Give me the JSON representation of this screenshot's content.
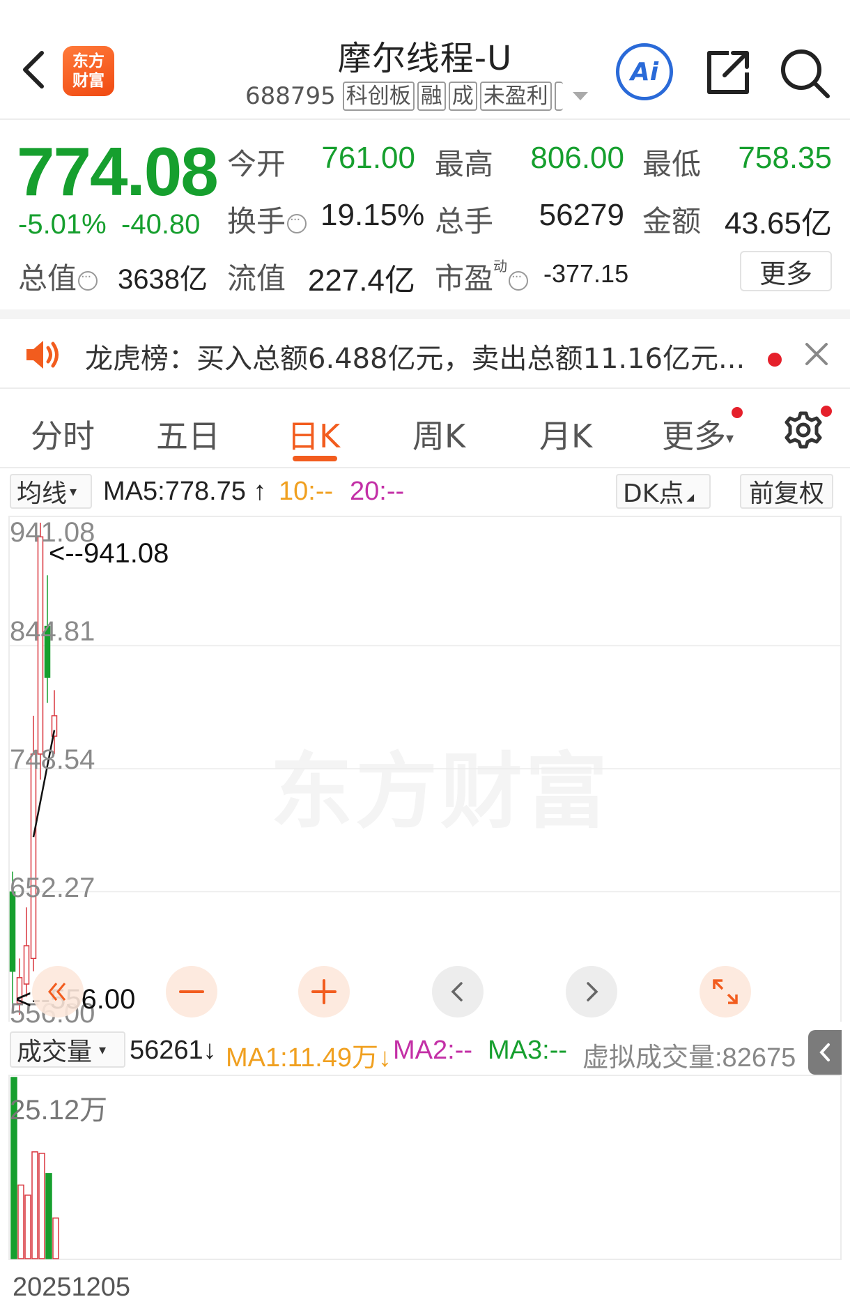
{
  "header": {
    "logo_line1": "东方",
    "logo_line2": "财富",
    "stock_name": "摩尔线程-U",
    "stock_code": "688795",
    "tags": [
      "科创板",
      "融",
      "成",
      "未盈利"
    ],
    "ai_label": "Ai"
  },
  "quote": {
    "price": "774.08",
    "change_pct": "-5.01%",
    "change_amt": "-40.80",
    "open_label": "今开",
    "open": "761.00",
    "high_label": "最高",
    "high": "806.00",
    "low_label": "最低",
    "low": "758.35",
    "turnover_label": "换手",
    "turnover": "19.15%",
    "volume_label": "总手",
    "volume": "56279",
    "amount_label": "金额",
    "amount": "43.65亿",
    "mktcap_label": "总值",
    "mktcap": "3638亿",
    "float_label": "流值",
    "float_cap": "227.4亿",
    "pe_label": "市盈",
    "pe_sup": "动",
    "pe": "-377.15",
    "more_label": "更多"
  },
  "notice": {
    "text": "龙虎榜：买入总额6.488亿元，卖出总额11.16亿元..."
  },
  "tabs": {
    "items": [
      "分时",
      "五日",
      "日K",
      "周K",
      "月K",
      "更多"
    ],
    "active": "日K"
  },
  "indicator_bar": {
    "ma_select": "均线",
    "ma5": "MA5:778.75",
    "ma10": "10:--",
    "ma20": "20:--",
    "dk_label": "DK点",
    "adjust_label": "前复权"
  },
  "chart_data": {
    "type": "candlestick",
    "y_ticks": [
      "941.08",
      "844.81",
      "748.54",
      "652.27",
      "556.00"
    ],
    "ylim": [
      556.0,
      941.08
    ],
    "max_marker": "<--941.08",
    "min_marker": "<--556.00",
    "candles": [
      {
        "open": 652,
        "close": 590,
        "high": 668,
        "low": 560
      },
      {
        "open": 565,
        "close": 585,
        "high": 600,
        "low": 556
      },
      {
        "open": 580,
        "close": 610,
        "high": 640,
        "low": 570
      },
      {
        "open": 600,
        "close": 760,
        "high": 790,
        "low": 590
      },
      {
        "open": 760,
        "close": 930,
        "high": 941.08,
        "low": 740
      },
      {
        "open": 860,
        "close": 820,
        "high": 900,
        "low": 800
      },
      {
        "open": 774,
        "close": 790,
        "high": 810,
        "low": 760
      }
    ],
    "ma5_line": [
      {
        "index": 3,
        "value": 695
      },
      {
        "index": 6,
        "value": 778.75
      }
    ],
    "volume_label": "成交量",
    "volume_value": "56261",
    "vol_ma1": "MA1:11.49万",
    "vol_ma2": "MA2:--",
    "vol_ma3": "MA3:--",
    "virtual_volume": "虚拟成交量:82675",
    "vol_max_label": "25.12万",
    "vol_max": 251200,
    "volumes": [
      {
        "value": 251200,
        "up": false
      },
      {
        "value": 102000,
        "up": true
      },
      {
        "value": 88000,
        "up": true
      },
      {
        "value": 148000,
        "up": true
      },
      {
        "value": 146000,
        "up": true
      },
      {
        "value": 118000,
        "up": false
      },
      {
        "value": 56261,
        "up": true
      }
    ],
    "date_label": "20251205"
  },
  "colors": {
    "up": "#d9363e",
    "down": "#169f2e",
    "accent": "#f25c1e",
    "ma10": "#f0a020",
    "ma20": "#c32fa6",
    "ma2": "#c32fa6",
    "ma3": "#169f2e"
  },
  "icons": {
    "back": "chevron-left-icon",
    "share": "share-icon",
    "search": "search-icon",
    "speaker": "speaker-icon",
    "close": "close-icon",
    "gear": "gear-icon"
  }
}
